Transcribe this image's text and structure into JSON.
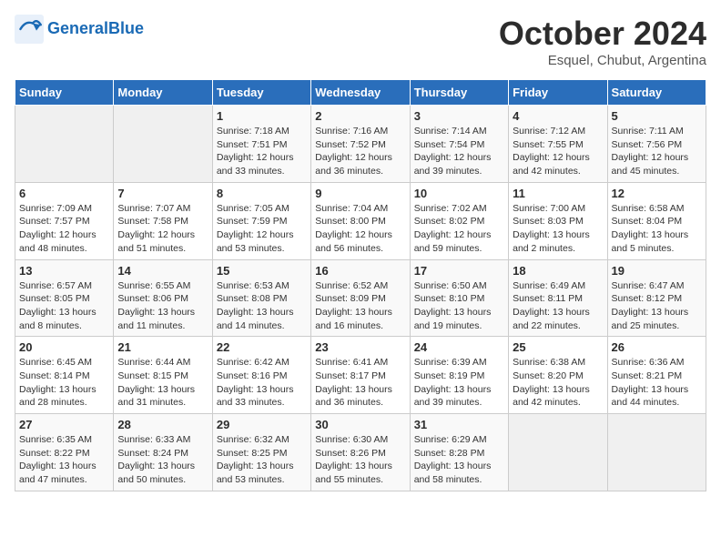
{
  "header": {
    "logo_line1": "General",
    "logo_line2": "Blue",
    "month": "October 2024",
    "location": "Esquel, Chubut, Argentina"
  },
  "days_of_week": [
    "Sunday",
    "Monday",
    "Tuesday",
    "Wednesday",
    "Thursday",
    "Friday",
    "Saturday"
  ],
  "weeks": [
    [
      {
        "day": "",
        "sunrise": "",
        "sunset": "",
        "daylight": ""
      },
      {
        "day": "",
        "sunrise": "",
        "sunset": "",
        "daylight": ""
      },
      {
        "day": "1",
        "sunrise": "Sunrise: 7:18 AM",
        "sunset": "Sunset: 7:51 PM",
        "daylight": "Daylight: 12 hours and 33 minutes."
      },
      {
        "day": "2",
        "sunrise": "Sunrise: 7:16 AM",
        "sunset": "Sunset: 7:52 PM",
        "daylight": "Daylight: 12 hours and 36 minutes."
      },
      {
        "day": "3",
        "sunrise": "Sunrise: 7:14 AM",
        "sunset": "Sunset: 7:54 PM",
        "daylight": "Daylight: 12 hours and 39 minutes."
      },
      {
        "day": "4",
        "sunrise": "Sunrise: 7:12 AM",
        "sunset": "Sunset: 7:55 PM",
        "daylight": "Daylight: 12 hours and 42 minutes."
      },
      {
        "day": "5",
        "sunrise": "Sunrise: 7:11 AM",
        "sunset": "Sunset: 7:56 PM",
        "daylight": "Daylight: 12 hours and 45 minutes."
      }
    ],
    [
      {
        "day": "6",
        "sunrise": "Sunrise: 7:09 AM",
        "sunset": "Sunset: 7:57 PM",
        "daylight": "Daylight: 12 hours and 48 minutes."
      },
      {
        "day": "7",
        "sunrise": "Sunrise: 7:07 AM",
        "sunset": "Sunset: 7:58 PM",
        "daylight": "Daylight: 12 hours and 51 minutes."
      },
      {
        "day": "8",
        "sunrise": "Sunrise: 7:05 AM",
        "sunset": "Sunset: 7:59 PM",
        "daylight": "Daylight: 12 hours and 53 minutes."
      },
      {
        "day": "9",
        "sunrise": "Sunrise: 7:04 AM",
        "sunset": "Sunset: 8:00 PM",
        "daylight": "Daylight: 12 hours and 56 minutes."
      },
      {
        "day": "10",
        "sunrise": "Sunrise: 7:02 AM",
        "sunset": "Sunset: 8:02 PM",
        "daylight": "Daylight: 12 hours and 59 minutes."
      },
      {
        "day": "11",
        "sunrise": "Sunrise: 7:00 AM",
        "sunset": "Sunset: 8:03 PM",
        "daylight": "Daylight: 13 hours and 2 minutes."
      },
      {
        "day": "12",
        "sunrise": "Sunrise: 6:58 AM",
        "sunset": "Sunset: 8:04 PM",
        "daylight": "Daylight: 13 hours and 5 minutes."
      }
    ],
    [
      {
        "day": "13",
        "sunrise": "Sunrise: 6:57 AM",
        "sunset": "Sunset: 8:05 PM",
        "daylight": "Daylight: 13 hours and 8 minutes."
      },
      {
        "day": "14",
        "sunrise": "Sunrise: 6:55 AM",
        "sunset": "Sunset: 8:06 PM",
        "daylight": "Daylight: 13 hours and 11 minutes."
      },
      {
        "day": "15",
        "sunrise": "Sunrise: 6:53 AM",
        "sunset": "Sunset: 8:08 PM",
        "daylight": "Daylight: 13 hours and 14 minutes."
      },
      {
        "day": "16",
        "sunrise": "Sunrise: 6:52 AM",
        "sunset": "Sunset: 8:09 PM",
        "daylight": "Daylight: 13 hours and 16 minutes."
      },
      {
        "day": "17",
        "sunrise": "Sunrise: 6:50 AM",
        "sunset": "Sunset: 8:10 PM",
        "daylight": "Daylight: 13 hours and 19 minutes."
      },
      {
        "day": "18",
        "sunrise": "Sunrise: 6:49 AM",
        "sunset": "Sunset: 8:11 PM",
        "daylight": "Daylight: 13 hours and 22 minutes."
      },
      {
        "day": "19",
        "sunrise": "Sunrise: 6:47 AM",
        "sunset": "Sunset: 8:12 PM",
        "daylight": "Daylight: 13 hours and 25 minutes."
      }
    ],
    [
      {
        "day": "20",
        "sunrise": "Sunrise: 6:45 AM",
        "sunset": "Sunset: 8:14 PM",
        "daylight": "Daylight: 13 hours and 28 minutes."
      },
      {
        "day": "21",
        "sunrise": "Sunrise: 6:44 AM",
        "sunset": "Sunset: 8:15 PM",
        "daylight": "Daylight: 13 hours and 31 minutes."
      },
      {
        "day": "22",
        "sunrise": "Sunrise: 6:42 AM",
        "sunset": "Sunset: 8:16 PM",
        "daylight": "Daylight: 13 hours and 33 minutes."
      },
      {
        "day": "23",
        "sunrise": "Sunrise: 6:41 AM",
        "sunset": "Sunset: 8:17 PM",
        "daylight": "Daylight: 13 hours and 36 minutes."
      },
      {
        "day": "24",
        "sunrise": "Sunrise: 6:39 AM",
        "sunset": "Sunset: 8:19 PM",
        "daylight": "Daylight: 13 hours and 39 minutes."
      },
      {
        "day": "25",
        "sunrise": "Sunrise: 6:38 AM",
        "sunset": "Sunset: 8:20 PM",
        "daylight": "Daylight: 13 hours and 42 minutes."
      },
      {
        "day": "26",
        "sunrise": "Sunrise: 6:36 AM",
        "sunset": "Sunset: 8:21 PM",
        "daylight": "Daylight: 13 hours and 44 minutes."
      }
    ],
    [
      {
        "day": "27",
        "sunrise": "Sunrise: 6:35 AM",
        "sunset": "Sunset: 8:22 PM",
        "daylight": "Daylight: 13 hours and 47 minutes."
      },
      {
        "day": "28",
        "sunrise": "Sunrise: 6:33 AM",
        "sunset": "Sunset: 8:24 PM",
        "daylight": "Daylight: 13 hours and 50 minutes."
      },
      {
        "day": "29",
        "sunrise": "Sunrise: 6:32 AM",
        "sunset": "Sunset: 8:25 PM",
        "daylight": "Daylight: 13 hours and 53 minutes."
      },
      {
        "day": "30",
        "sunrise": "Sunrise: 6:30 AM",
        "sunset": "Sunset: 8:26 PM",
        "daylight": "Daylight: 13 hours and 55 minutes."
      },
      {
        "day": "31",
        "sunrise": "Sunrise: 6:29 AM",
        "sunset": "Sunset: 8:28 PM",
        "daylight": "Daylight: 13 hours and 58 minutes."
      },
      {
        "day": "",
        "sunrise": "",
        "sunset": "",
        "daylight": ""
      },
      {
        "day": "",
        "sunrise": "",
        "sunset": "",
        "daylight": ""
      }
    ]
  ]
}
